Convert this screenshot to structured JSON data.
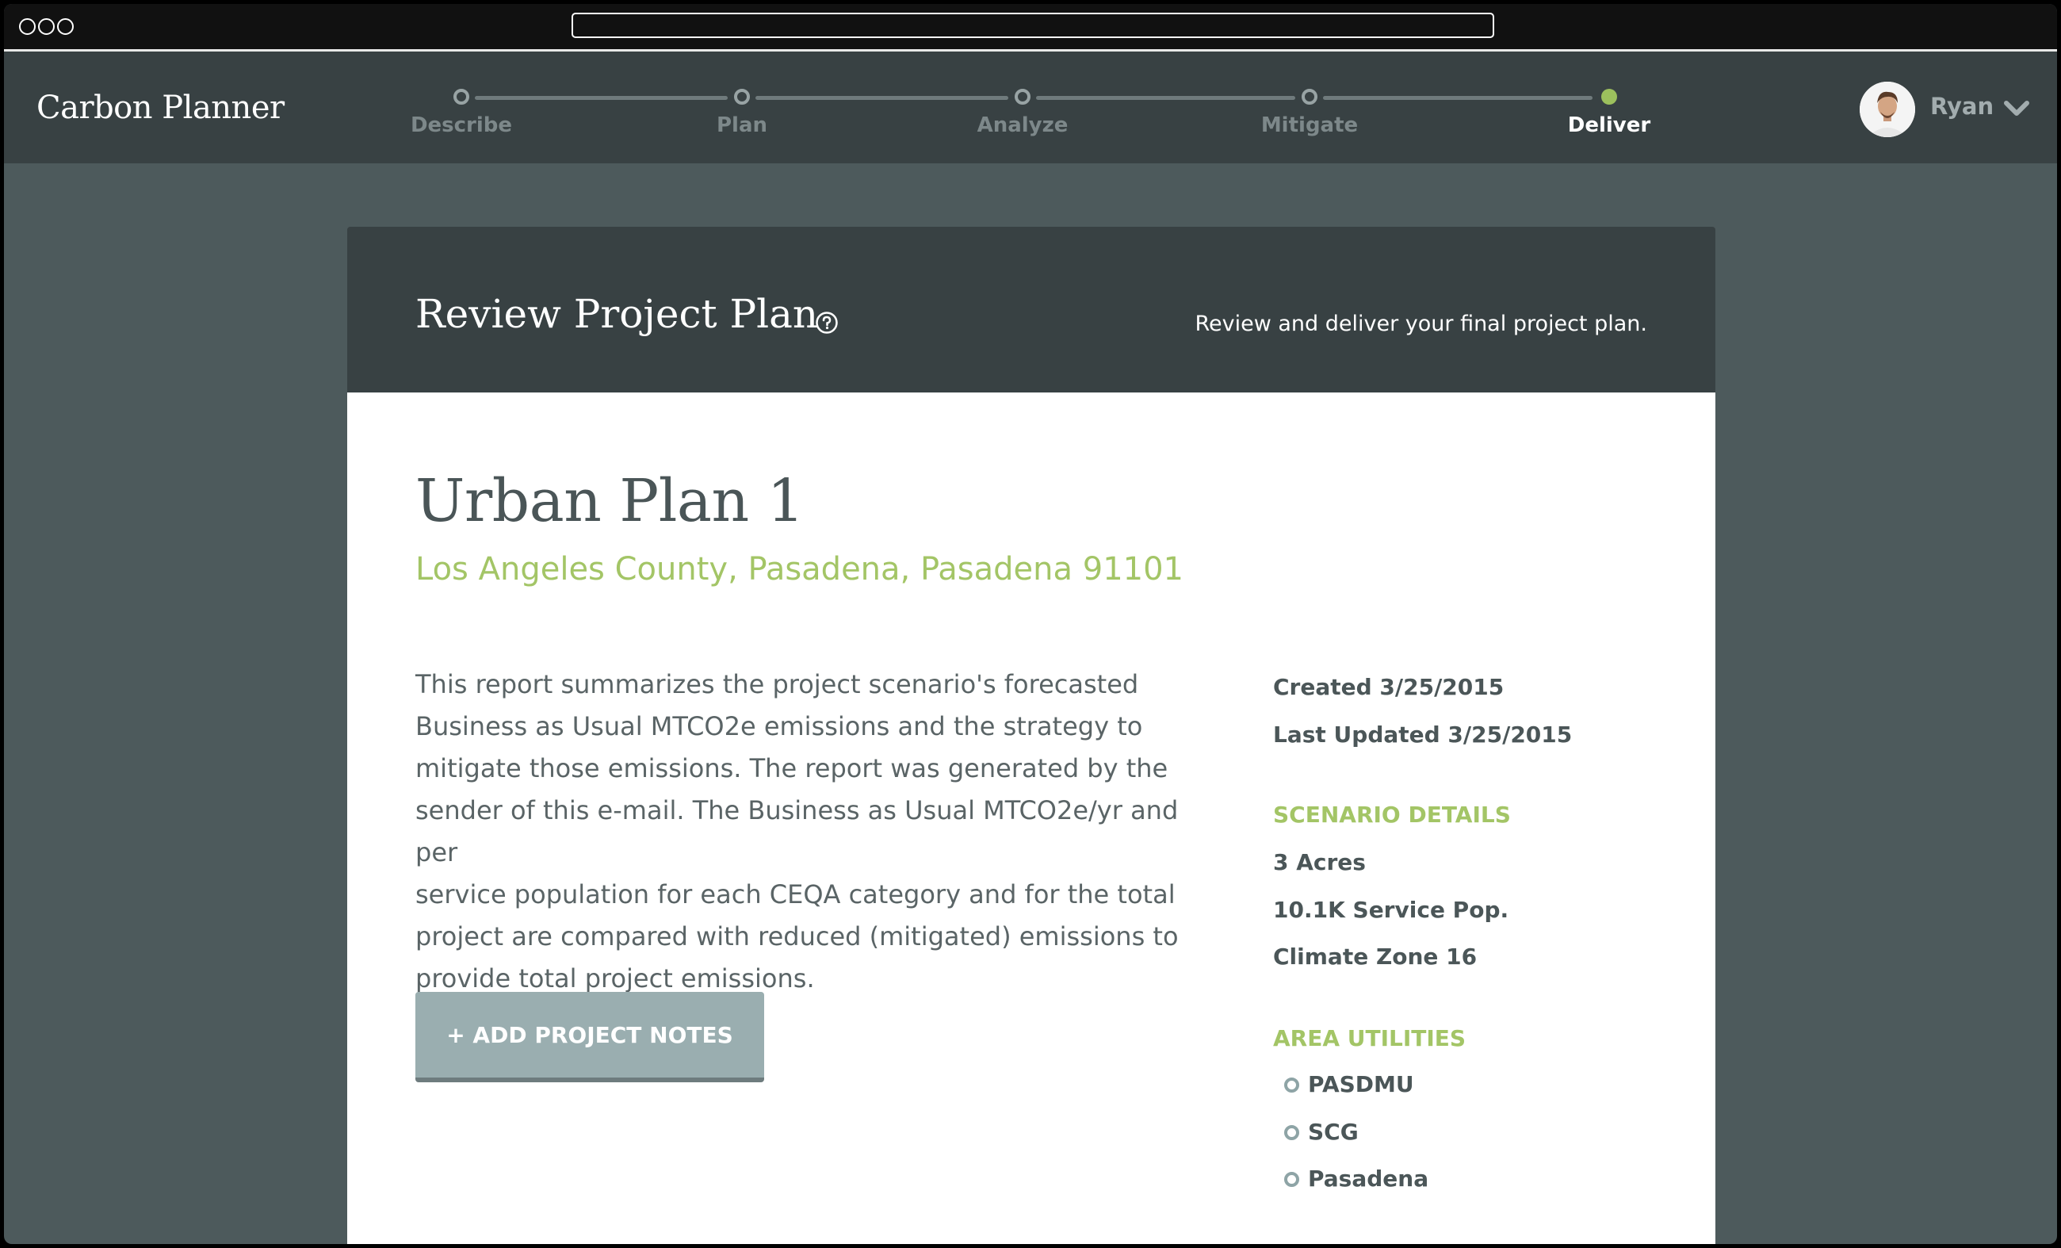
{
  "app": {
    "brand": "Carbon Planner"
  },
  "steps": [
    {
      "label": "Describe",
      "active": false
    },
    {
      "label": "Plan",
      "active": false
    },
    {
      "label": "Analyze",
      "active": false
    },
    {
      "label": "Mitigate",
      "active": false
    },
    {
      "label": "Deliver",
      "active": true
    }
  ],
  "user": {
    "name": "Ryan"
  },
  "card": {
    "title": "Review Project Plan",
    "subtitle": "Review and deliver your final project plan."
  },
  "plan": {
    "name": "Urban Plan 1",
    "location": "Los Angeles County, Pasadena, Pasadena 91101",
    "description_lines": [
      "This report summarizes the project scenario's forecasted",
      "Business as Usual MTCO2e emissions and the strategy to",
      "mitigate those emissions. The report was generated by the",
      "sender of this e-mail. The Business as Usual MTCO2e/yr and per",
      "service population for each CEQA category and for the total",
      "project are compared with reduced (mitigated) emissions to",
      "provide total project emissions."
    ],
    "notes_button": "+ ADD PROJECT NOTES",
    "created": "Created 3/25/2015",
    "updated": "Last Updated 3/25/2015",
    "scenario_heading": "SCENARIO DETAILS",
    "scenario_details": [
      "3 Acres",
      "10.1K Service Pop.",
      "Climate Zone 16"
    ],
    "utilities_heading": "AREA UTILITIES",
    "utilities": [
      "PASDMU",
      "SCG",
      "Pasadena"
    ]
  },
  "colors": {
    "accent": "#9cc05d",
    "header": "#384143",
    "background": "#4d5a5c",
    "button": "#9aaeb0"
  },
  "icons": {
    "help": "help-circle-icon",
    "user_menu": "chevron-down-icon"
  }
}
